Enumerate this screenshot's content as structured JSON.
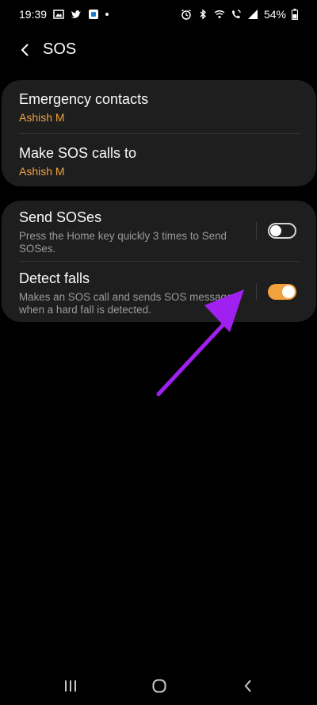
{
  "status": {
    "time": "19:39",
    "battery": "54%"
  },
  "header": {
    "title": "SOS"
  },
  "card1": {
    "emergency_contacts": {
      "title": "Emergency contacts",
      "value": "Ashish M"
    },
    "make_sos_calls": {
      "title": "Make SOS calls to",
      "value": "Ashish M"
    }
  },
  "card2": {
    "send_soses": {
      "title": "Send SOSes",
      "desc": "Press the Home key quickly 3 times to Send SOSes.",
      "enabled": false
    },
    "detect_falls": {
      "title": "Detect falls",
      "desc": "Makes an SOS call and sends SOS messages when a hard fall is detected.",
      "enabled": true
    }
  },
  "colors": {
    "accent": "#f2a23c",
    "card": "#1e1e1f",
    "annotation_arrow": "#a020f0"
  }
}
